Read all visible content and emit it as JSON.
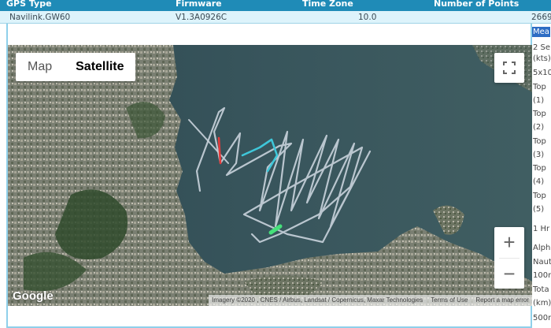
{
  "table": {
    "headers": [
      "GPS Type",
      "Firmware",
      "Time Zone",
      "Number of Points"
    ],
    "row": [
      "Navilink.GW60",
      "V1.3A0926C",
      "10.0",
      "2669"
    ]
  },
  "map": {
    "type_controls": [
      "Map",
      "Satellite"
    ],
    "active_type": "Satellite",
    "fullscreen_icon": "fullscreen-icon",
    "zoom_in": "+",
    "zoom_out": "−",
    "logo": "Google",
    "attribution": "Imagery ©2020 , CNES / Airbus, Landsat / Copernicus, Maxar Technologies",
    "terms": "Terms of Use",
    "report": "Report a map error",
    "track_colors": {
      "main": "#c9d3dc",
      "fast": "#3fc7d9",
      "alert": "#e33b3b",
      "start": "#45e07a"
    }
  },
  "side": {
    "highlight": "Mea",
    "lines": [
      "2 Se",
      "(kts)",
      "5x10",
      "Top",
      "(1)",
      "Top",
      "(2)",
      "Top",
      "(3)",
      "Top",
      "(4)",
      "Top",
      "(5)",
      "1 Hr",
      "Alph",
      "Naut",
      "100m",
      "Tota",
      "(km)",
      "500m"
    ]
  }
}
